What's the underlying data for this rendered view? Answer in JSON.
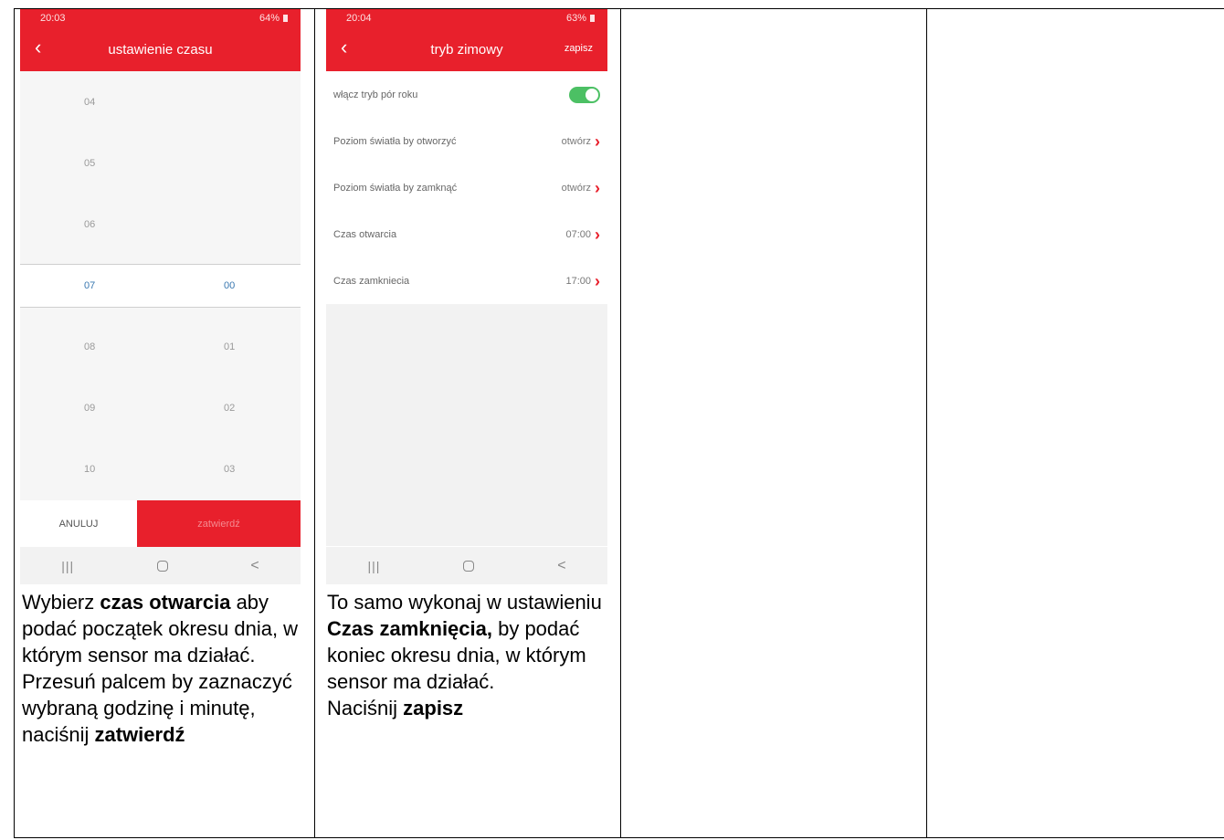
{
  "phone1": {
    "status_time": "20:03",
    "status_battery": "64%",
    "title": "ustawienie czasu",
    "picker": {
      "hours_above": [
        "04",
        "05",
        "06"
      ],
      "selected_hour": "07",
      "selected_minute": "00",
      "rows_below": [
        {
          "hour": "08",
          "minute": "01"
        },
        {
          "hour": "09",
          "minute": "02"
        },
        {
          "hour": "10",
          "minute": "03"
        }
      ]
    },
    "cancel_label": "ANULUJ",
    "confirm_label": "zatwierdź"
  },
  "phone2": {
    "status_time": "20:04",
    "status_battery": "63%",
    "title": "tryb zimowy",
    "save_label": "zapisz",
    "rows": [
      {
        "label": "włącz tryb pór roku",
        "value": ""
      },
      {
        "label": "Poziom światła by otworzyć",
        "value": "otwórz"
      },
      {
        "label": "Poziom światła by zamknąć",
        "value": "otwórz"
      },
      {
        "label": "Czas otwarcia",
        "value": "07:00"
      },
      {
        "label": "Czas zamkniecia",
        "value": "17:00"
      }
    ],
    "season_toggle_on": true
  },
  "navbar": {
    "recent": "|||",
    "back": "<"
  },
  "caption1": {
    "t1": "Wybierz ",
    "b1": "czas otwarcia",
    "t2": " aby podać początek okresu dnia, w którym sensor ma działać. Przesuń palcem by zaznaczyć wybraną godzinę i minutę, naciśnij ",
    "b2": "zatwierdź"
  },
  "caption2": {
    "t1": "To samo wykonaj w ustawieniu ",
    "b1": "Czas zamknięcia,",
    "t2": " by podać koniec okresu dnia, w którym sensor ma działać.",
    "t3": "Naciśnij ",
    "b2": "zapisz"
  },
  "colors": {
    "accent": "#e8202c",
    "toggle_on": "#4cc064",
    "selected_time": "#3a78b0"
  }
}
